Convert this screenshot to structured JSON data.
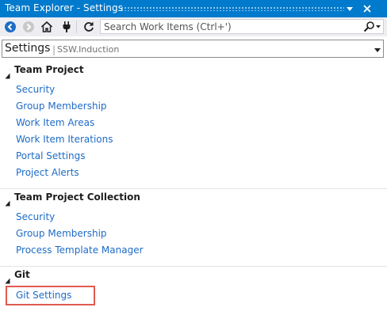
{
  "titlebar": {
    "title": "Team Explorer - Settings"
  },
  "toolbar": {
    "search_placeholder": "Search Work Items (Ctrl+')",
    "icons": [
      "back-arrow-icon",
      "forward-arrow-icon",
      "home-icon",
      "connect-plug-icon",
      "refresh-icon",
      "search-icon",
      "chevron-down-icon"
    ]
  },
  "header": {
    "title": "Settings",
    "separator": "|",
    "context": "SSW.Induction"
  },
  "sections": {
    "team_project": {
      "title": "Team Project",
      "links": [
        "Security",
        "Group Membership",
        "Work Item Areas",
        "Work Item Iterations",
        "Portal Settings",
        "Project Alerts"
      ]
    },
    "collection": {
      "title": "Team Project Collection",
      "links": [
        "Security",
        "Group Membership",
        "Process Template Manager"
      ]
    },
    "git": {
      "title": "Git",
      "links": [
        "Git Settings"
      ],
      "highlighted_link": "Git Settings"
    }
  },
  "colors": {
    "titlebar": "#007acc",
    "toolbar": "#eeeef2",
    "link": "#1e6cc7",
    "highlight_border": "#e05a50"
  }
}
